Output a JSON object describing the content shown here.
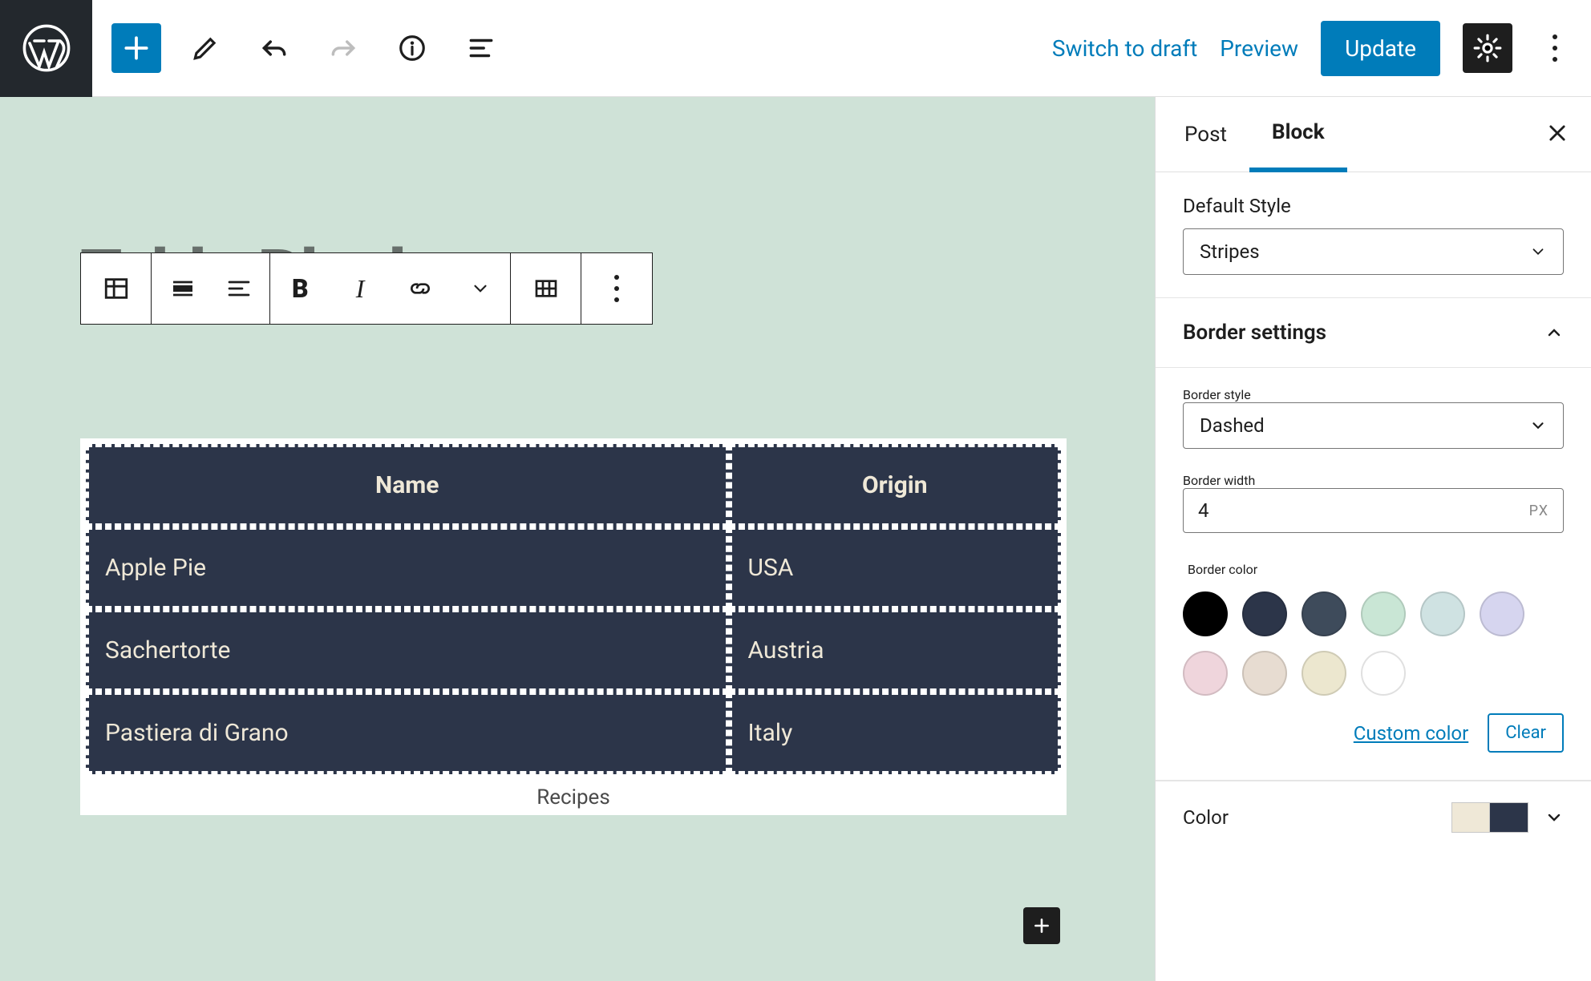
{
  "topbar": {
    "switch_to_draft": "Switch to draft",
    "preview": "Preview",
    "update": "Update"
  },
  "page": {
    "title_ghost": "Table Block"
  },
  "table": {
    "headers": [
      "Name",
      "Origin"
    ],
    "rows": [
      [
        "Apple Pie",
        "USA"
      ],
      [
        "Sachertorte",
        "Austria"
      ],
      [
        "Pastiera di Grano",
        "Italy"
      ]
    ],
    "caption": "Recipes"
  },
  "sidebar": {
    "tabs": {
      "post": "Post",
      "block": "Block"
    },
    "default_style": {
      "label": "Default Style",
      "value": "Stripes"
    },
    "border_settings": {
      "title": "Border settings",
      "style_label": "Border style",
      "style_value": "Dashed",
      "width_label": "Border width",
      "width_value": "4",
      "width_unit": "PX",
      "color_label": "Border color",
      "custom_color": "Custom color",
      "clear": "Clear",
      "palette": [
        "#000000",
        "#2c3549",
        "#3e4b5b",
        "#c9e6d5",
        "#cfe2e2",
        "#d6d5ef",
        "#efd5dc",
        "#e7dcd1",
        "#ece7cf",
        "#ffffff"
      ],
      "selected_index": 0
    },
    "color": {
      "label": "Color",
      "chips": [
        "#efe8d7",
        "#2c3549"
      ]
    }
  }
}
